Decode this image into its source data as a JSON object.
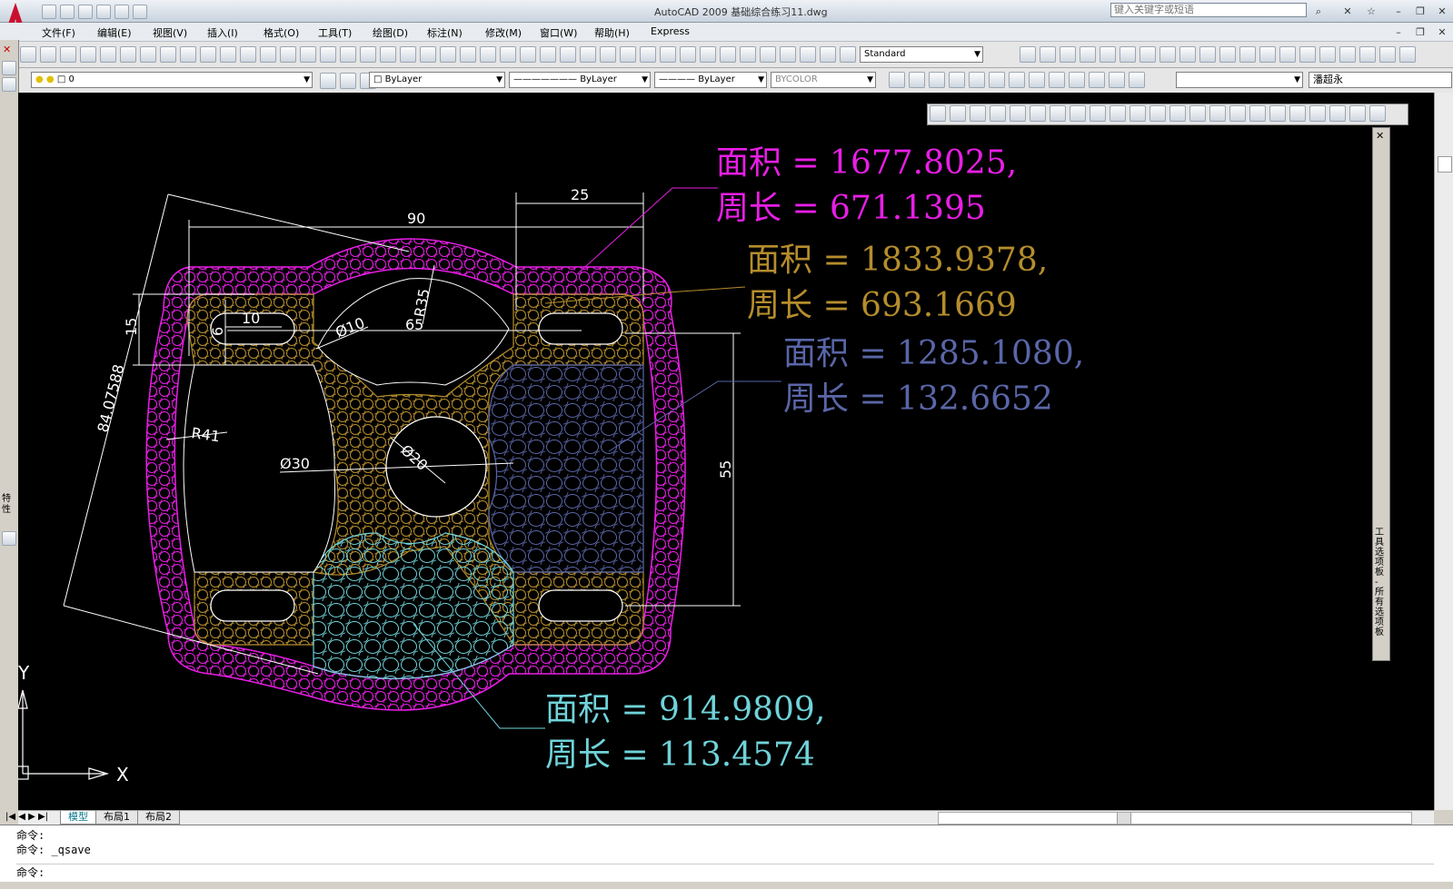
{
  "window": {
    "title": "AutoCAD 2009 基础综合练习11.dwg",
    "search_placeholder": "键入关键字或短语"
  },
  "menu": [
    "文件(F)",
    "编辑(E)",
    "视图(V)",
    "插入(I)",
    "格式(O)",
    "工具(T)",
    "绘图(D)",
    "标注(N)",
    "修改(M)",
    "窗口(W)",
    "帮助(H)",
    "Express"
  ],
  "toolbar": {
    "text_style": "Standard",
    "layer": "0",
    "color": "ByLayer",
    "linetype": "ByLayer",
    "lineweight": "ByLayer",
    "plotstyle": "BYCOLOR",
    "user": "潘超永"
  },
  "colors": {
    "magenta": "#e91ee6",
    "gold": "#b58d2c",
    "slate": "#5a66a8",
    "cyan": "#6fd3d9",
    "canvas": "#000000"
  },
  "annotations": [
    {
      "area_label": "面积 = 1677.8025,",
      "perim_label": "周长 = 671.1395",
      "color": "#e91ee6"
    },
    {
      "area_label": "面积 = 1833.9378,",
      "perim_label": "周长 = 693.1669",
      "color": "#b58d2c"
    },
    {
      "area_label": "面积 = 1285.1080,",
      "perim_label": "周长 = 132.6652",
      "color": "#5a66a8"
    },
    {
      "area_label": "面积 = 914.9809,",
      "perim_label": "周长 = 113.4574",
      "color": "#6fd3d9"
    }
  ],
  "dimensions": {
    "d25": "25",
    "d90": "90",
    "d15": "15",
    "d10": "10",
    "d6": "6",
    "r35": "R35",
    "phi10": "Ø10",
    "d65": "65",
    "d84": "84.07588",
    "r41": "R41",
    "phi30": "Ø30",
    "phi20": "Ø20",
    "d55": "55"
  },
  "ucs": {
    "x": "X",
    "y": "Y"
  },
  "tabs": [
    "模型",
    "布局1",
    "布局2"
  ],
  "palette_label": "工具选项板 - 所有选项板",
  "side_label": "特性",
  "command_lines": [
    "命令:",
    "命令: _qsave",
    "命令:"
  ]
}
